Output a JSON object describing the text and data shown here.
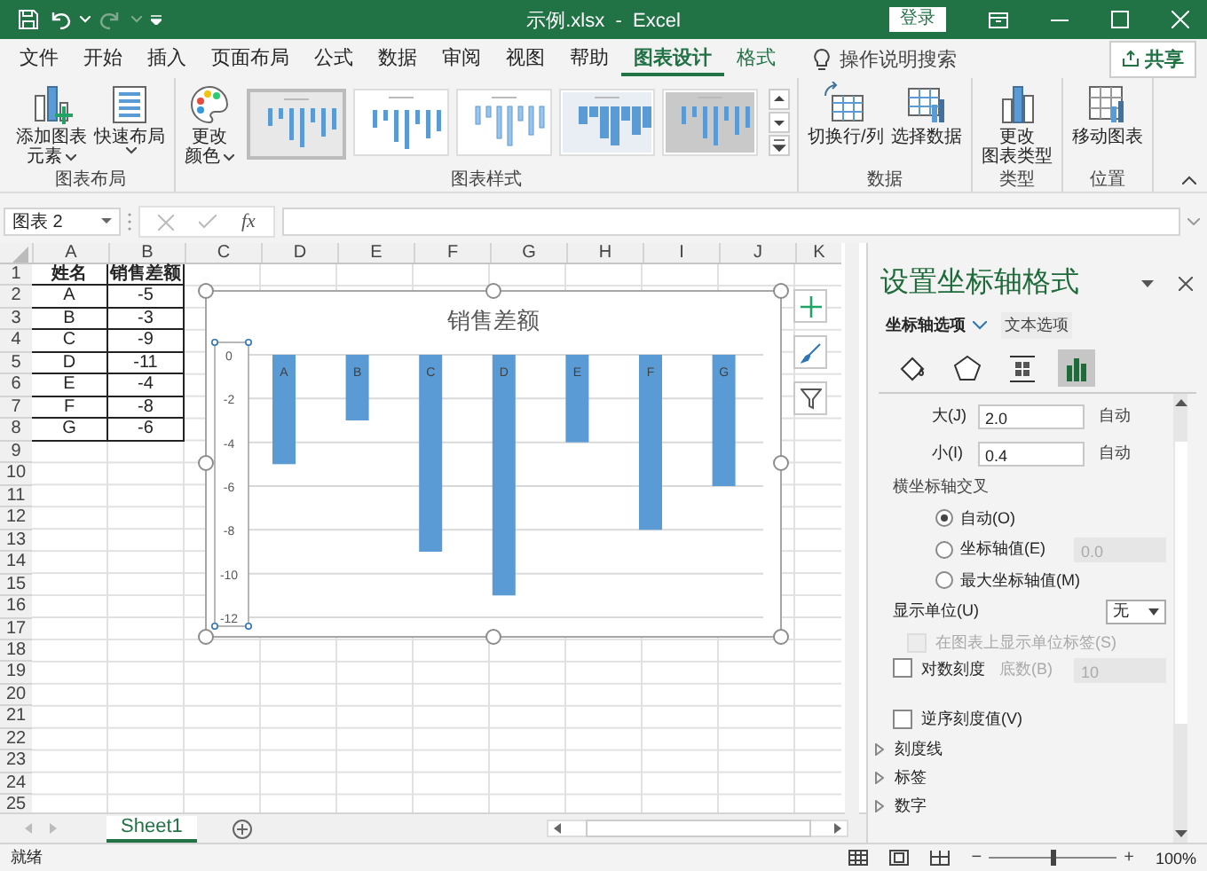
{
  "title_bar": {
    "title": "示例.xlsx  -  Excel",
    "login": "登录"
  },
  "menu": {
    "tabs": [
      {
        "label": "文件",
        "selected": false,
        "contextual": false
      },
      {
        "label": "开始",
        "selected": false,
        "contextual": false
      },
      {
        "label": "插入",
        "selected": false,
        "contextual": false
      },
      {
        "label": "页面布局",
        "selected": false,
        "contextual": false
      },
      {
        "label": "公式",
        "selected": false,
        "contextual": false
      },
      {
        "label": "数据",
        "selected": false,
        "contextual": false
      },
      {
        "label": "审阅",
        "selected": false,
        "contextual": false
      },
      {
        "label": "视图",
        "selected": false,
        "contextual": false
      },
      {
        "label": "帮助",
        "selected": false,
        "contextual": false
      },
      {
        "label": "图表设计",
        "selected": true,
        "contextual": true
      },
      {
        "label": "格式",
        "selected": false,
        "contextual": true
      }
    ],
    "search": "操作说明搜索",
    "share": "共享"
  },
  "ribbon": {
    "groups": [
      {
        "label": "图表布局",
        "buttons": [
          {
            "kind": "add-element",
            "lines": [
              "添加图表",
              "元素"
            ],
            "dropdown": true
          },
          {
            "kind": "quick-layout",
            "lines": [
              "快速布局"
            ],
            "dropdown": true
          }
        ]
      },
      {
        "label": "图表样式",
        "buttons": [
          {
            "kind": "palette",
            "lines": [
              "更改",
              "颜色"
            ],
            "dropdown": true
          }
        ],
        "gallery": [
          {
            "kind": "plain",
            "selected": true
          },
          {
            "kind": "labels",
            "selected": false
          },
          {
            "kind": "pattern",
            "selected": false
          },
          {
            "kind": "shaded",
            "selected": false
          },
          {
            "kind": "dark",
            "selected": false
          }
        ]
      },
      {
        "label": "数据",
        "buttons": [
          {
            "kind": "switch",
            "lines": [
              "切换行/列"
            ],
            "dropdown": false
          },
          {
            "kind": "select-data",
            "lines": [
              "选择数据"
            ],
            "dropdown": false
          }
        ]
      },
      {
        "label": "类型",
        "buttons": [
          {
            "kind": "change-type",
            "lines": [
              "更改",
              "图表类型"
            ],
            "dropdown": false
          }
        ]
      },
      {
        "label": "位置",
        "buttons": [
          {
            "kind": "move",
            "lines": [
              "移动图表"
            ],
            "dropdown": false
          }
        ]
      }
    ]
  },
  "formula_bar": {
    "name_box": "图表 2",
    "function_label": "fx"
  },
  "sheet": {
    "columns": [
      "A",
      "B",
      "C",
      "D",
      "E",
      "F",
      "G",
      "H",
      "I",
      "J",
      "K"
    ],
    "rows": [
      {
        "number": "1",
        "cells": [
          "姓名",
          "销售差额"
        ],
        "header": true
      },
      {
        "number": "2",
        "cells": [
          "A",
          "-5"
        ],
        "header": false
      },
      {
        "number": "3",
        "cells": [
          "B",
          "-3"
        ],
        "header": false
      },
      {
        "number": "4",
        "cells": [
          "C",
          "-9"
        ],
        "header": false
      },
      {
        "number": "5",
        "cells": [
          "D",
          "-11"
        ],
        "header": false
      },
      {
        "number": "6",
        "cells": [
          "E",
          "-4"
        ],
        "header": false
      },
      {
        "number": "7",
        "cells": [
          "F",
          "-8"
        ],
        "header": false
      },
      {
        "number": "8",
        "cells": [
          "G",
          "-6"
        ],
        "header": false
      },
      {
        "number": "9"
      },
      {
        "number": "10"
      },
      {
        "number": "11"
      },
      {
        "number": "12"
      },
      {
        "number": "13"
      },
      {
        "number": "14"
      },
      {
        "number": "15"
      },
      {
        "number": "16"
      },
      {
        "number": "17"
      },
      {
        "number": "18"
      },
      {
        "number": "19"
      },
      {
        "number": "20"
      },
      {
        "number": "21"
      },
      {
        "number": "22"
      },
      {
        "number": "23"
      },
      {
        "number": "24"
      },
      {
        "number": "25"
      }
    ],
    "chart_data": {
      "type": "bar",
      "title": "销售差额",
      "categories": [
        "A",
        "B",
        "C",
        "D",
        "E",
        "F",
        "G"
      ],
      "series": [
        {
          "color": "#5b9bd5",
          "values": [
            -5,
            -3,
            -9,
            -11,
            -4,
            -8,
            -6
          ]
        }
      ],
      "ylim": [
        -12,
        0
      ],
      "grid": true,
      "yticks": [
        0,
        -2,
        -4,
        -6,
        -8,
        -10,
        -12
      ]
    },
    "tabs": [
      {
        "label": "Sheet1",
        "selected": true
      }
    ]
  },
  "pane": {
    "title": "设置坐标轴格式",
    "tabs": [
      {
        "label": "坐标轴选项",
        "selected": true,
        "dropdown": true
      },
      {
        "label": "文本选项",
        "selected": false,
        "dropdown": false
      }
    ],
    "icon_tabs": [
      {
        "kind": "fill",
        "selected": false
      },
      {
        "kind": "effects",
        "selected": false
      },
      {
        "kind": "size",
        "selected": false
      },
      {
        "kind": "axis",
        "selected": true
      }
    ],
    "rows": [
      {
        "kind": "field",
        "label": "大(J)",
        "value": "2.0",
        "reset": "自动"
      },
      {
        "kind": "field",
        "label": "小(I)",
        "value": "0.4",
        "reset": "自动"
      },
      {
        "kind": "heading",
        "label": "横坐标轴交叉"
      },
      {
        "kind": "radio",
        "label": "自动(O)",
        "selected": true
      },
      {
        "kind": "radio",
        "label": "坐标轴值(E)",
        "selected": false,
        "value": "0.0"
      },
      {
        "kind": "radio",
        "label": "最大坐标轴值(M)",
        "selected": false
      },
      {
        "kind": "select",
        "label": "显示单位(U)",
        "value": "无"
      },
      {
        "kind": "checkbox",
        "label": "在图表上显示单位标签(S)",
        "checked": false,
        "disabled": true
      },
      {
        "kind": "checkbox",
        "label": "对数刻度",
        "checked": false,
        "disabled": false,
        "sub_label": "底数(B)",
        "value": "10"
      },
      {
        "kind": "checkbox",
        "label": "逆序刻度值(V)",
        "checked": false,
        "disabled": false
      },
      {
        "kind": "section",
        "label": "刻度线",
        "expanded": false
      },
      {
        "kind": "section",
        "label": "标签",
        "expanded": false
      },
      {
        "kind": "section",
        "label": "数字",
        "expanded": false
      }
    ]
  },
  "status_bar": {
    "text": "就绪",
    "zoom": "100%",
    "zoom_out": "−",
    "zoom_in": "+",
    "zoom_slider": {
      "level": 0.5
    }
  }
}
